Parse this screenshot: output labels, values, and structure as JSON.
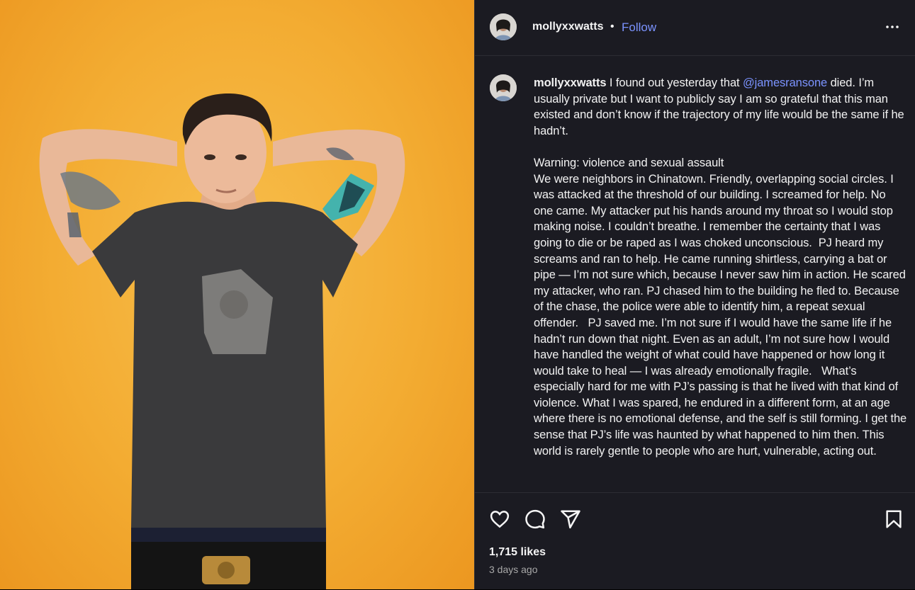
{
  "post": {
    "username": "mollyxxwatts",
    "separator": "•",
    "follow_label": "Follow",
    "more_icon": "more-horizontal-icon"
  },
  "caption": {
    "username": "mollyxxwatts",
    "lead": " I found out yesterday that ",
    "mention": "@jamesransone",
    "body": " died. I’m usually private but I want to publicly say I am so grateful that this man existed and don’t know if the trajectory of my life would be the same if he hadn’t.\n\nWarning: violence and sexual assault\nWe were neighbors in Chinatown. Friendly, overlapping social circles. I was attacked at the threshold of our building. I screamed for help. No one came. My attacker put his hands around my throat so I would stop making noise. I couldn’t breathe. I remember the certainty that I was going to die or be raped as I was choked unconscious.  PJ heard my screams and ran to help. He came running shirtless, carrying a bat or pipe — I’m not sure which, because I never saw him in action. He scared my attacker, who ran. PJ chased him to the building he fled to. Because of the chase, the police were able to identify him, a repeat sexual offender.   PJ saved me. I’m not sure if I would have the same life if he hadn’t run down that night. Even as an adult, I’m not sure how I would have handled the weight of what could have happened or how long it would take to heal — I was already emotionally fragile.   What’s especially hard for me with PJ’s passing is that he lived with that kind of violence. What I was spared, he endured in a different form, at an age where there is no emotional defense, and the self is still forming. I get the sense that PJ’s life was haunted by what happened to him then. This world is rarely gentle to people who are hurt, vulnerable, acting out."
  },
  "actions": {
    "like_icon": "heart-icon",
    "comment_icon": "comment-icon",
    "share_icon": "send-icon",
    "save_icon": "bookmark-icon"
  },
  "likes": "1,715 likes",
  "timestamp": "3 days ago",
  "colors": {
    "background": "#1b1b22",
    "link": "#7b93ff",
    "photo_backdrop": "#f3ac32"
  }
}
